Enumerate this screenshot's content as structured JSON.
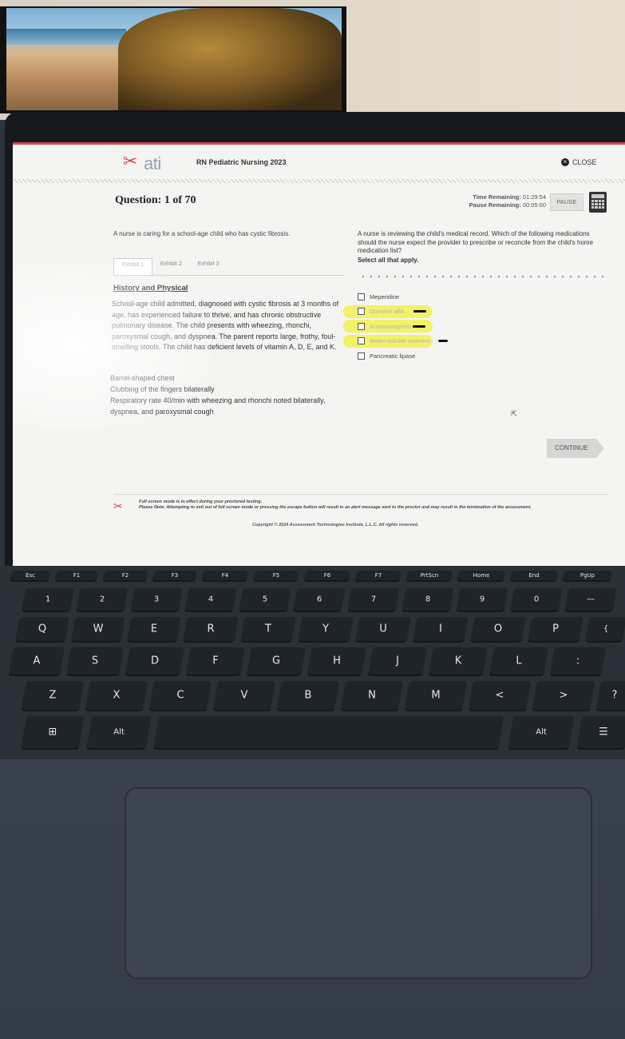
{
  "exam": {
    "logo_text": "ati",
    "title": "RN Pediatric Nursing 2023",
    "close_label": "CLOSE"
  },
  "question": {
    "counter": "Question: 1 of 70",
    "timer_label_remaining": "Time Remaining:",
    "timer_value_remaining": "01:29:54",
    "timer_label_pause": "Pause Remaining:",
    "timer_value_pause": "00:05:00",
    "pause_label": "PAUSE",
    "scenario": "A nurse is caring for a school-age child who has cystic fibrosis.",
    "prompt": "A nurse is reviewing the child's medical record. Which of the following medications should the nurse expect the provider to prescribe or reconcile from the child's home medication list?",
    "instruction": "Select all that apply."
  },
  "tabs": [
    "Exhibit 1",
    "Exhibit 2",
    "Exhibit 3"
  ],
  "history": {
    "title": "History and Physical",
    "body": "School-age child admitted, diagnosed with cystic fibrosis at 3 months of age, has experienced failure to thrive, and has chronic obstructive pulmonary disease. The child presents with wheezing, rhonchi, paroxysmal cough, and dyspnea. The parent reports large, frothy, foul-smelling stools. The child has deficient levels of vitamin A, D, E, and K.",
    "findings": [
      "Barrel-shaped chest",
      "Clubbing of the fingers bilaterally",
      "Respiratory rate 40/min with wheezing and rhonchi noted bilaterally, dyspnea, and paroxysmal cough"
    ]
  },
  "options": [
    {
      "label": "Meperidine",
      "highlighted": false
    },
    {
      "label": "Dornase alfa",
      "highlighted": true
    },
    {
      "label": "Acetaminophen",
      "highlighted": true
    },
    {
      "label": "Water-soluble vitamins",
      "highlighted": true
    },
    {
      "label": "Pancreatic lipase",
      "highlighted": false
    }
  ],
  "continue_label": "CONTINUE",
  "footer": {
    "note_line1": "Full screen mode is in effect during your proctored testing.",
    "note_line2": "Please Note: Attempting to exit out of full screen mode or pressing the escape button will result in an alert message sent to the proctor and may result in the termination of the assessment.",
    "copyright": "Copyright © 2024 Assessment Technologies Institute, L.L.C. All rights reserved."
  },
  "colors": {
    "brand_red": "#d4474e",
    "highlight": "#f0f03c",
    "keyboard": "#1f242b"
  },
  "keyboard": {
    "fn_row": [
      "Esc",
      "F1",
      "F2",
      "F3",
      "F4",
      "F5",
      "F6",
      "F7",
      "PrtScn",
      "Home",
      "End",
      "PgUp"
    ],
    "number_row": [
      "1",
      "2",
      "3",
      "4",
      "5",
      "6",
      "7",
      "8",
      "9",
      "0",
      "—"
    ],
    "top_row": [
      "Q",
      "W",
      "E",
      "R",
      "T",
      "Y",
      "U",
      "I",
      "O",
      "P",
      "{"
    ],
    "home_row": [
      "A",
      "S",
      "D",
      "F",
      "G",
      "H",
      "J",
      "K",
      "L",
      ":"
    ],
    "bottom_row": [
      "Z",
      "X",
      "C",
      "V",
      "B",
      "N",
      "M",
      "<",
      ">",
      "?"
    ],
    "alt_left": "Alt",
    "alt_right": "Alt"
  }
}
